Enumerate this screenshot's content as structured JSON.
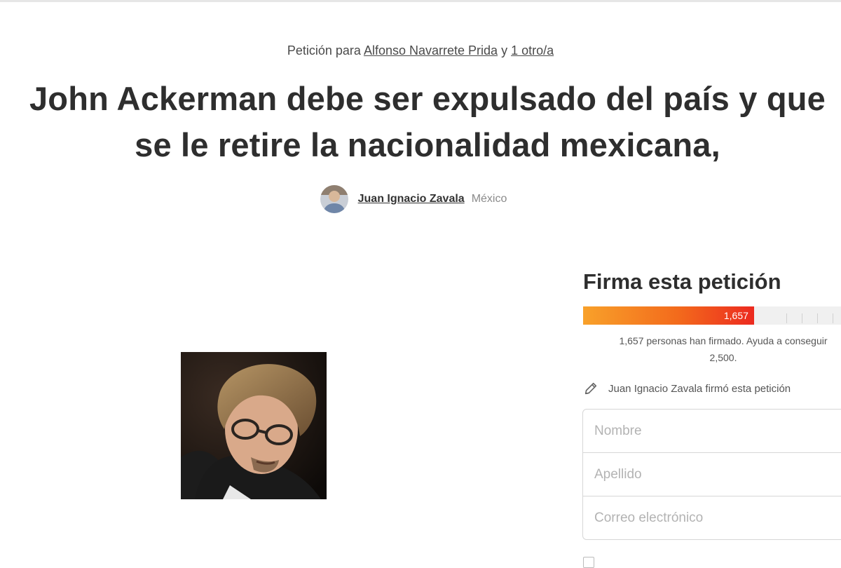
{
  "header": {
    "petition_prefix": "Petición para",
    "target_name": "Alfonso Navarrete Prida",
    "conjunction": "y",
    "others_link": "1 otro/a"
  },
  "petition": {
    "title_line1": "John Ackerman debe ser expulsado del país y que",
    "title_line2": "se le retire la nacionalidad mexicana,"
  },
  "author": {
    "name": "Juan Ignacio Zavala",
    "country": "México"
  },
  "sign_panel": {
    "title": "Firma esta petición",
    "progress": {
      "signatures": 1657,
      "goal": 2500,
      "label": "1,657"
    },
    "signed_line1": "1,657 personas han firmado. Ayuda a conseguir",
    "signed_line2": "2,500.",
    "recent_signer": "Juan Ignacio Zavala firmó esta petición",
    "fields": {
      "first_name_placeholder": "Nombre",
      "last_name_placeholder": "Apellido",
      "email_placeholder": "Correo electrónico"
    }
  },
  "colors": {
    "progress_start": "#f8a12a",
    "progress_end": "#ec2a1f",
    "text_dark": "#2e2e2e"
  }
}
